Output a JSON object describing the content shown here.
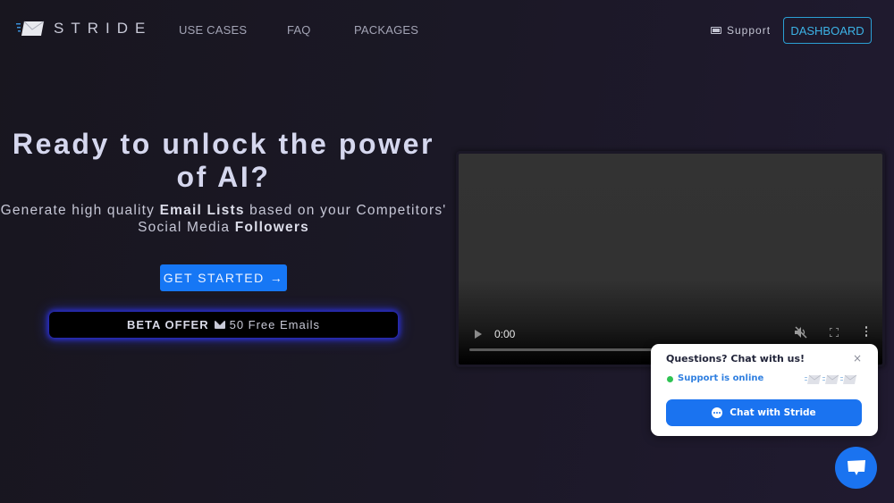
{
  "nav": {
    "logo_icon": "envelope-speed-icon",
    "brand": "STRIDE",
    "links": [
      {
        "label": "USE CASES"
      },
      {
        "label": "FAQ"
      },
      {
        "label": "PACKAGES"
      }
    ],
    "support_icon": "ticket-icon",
    "support_label": "Support",
    "dashboard_label": "DASHBOARD"
  },
  "hero": {
    "title": "Ready to unlock the power of AI?",
    "subtitle_parts": {
      "p1": "Generate high quality ",
      "b1": "Email Lists",
      "p2": " based on your Competitors' Social Media ",
      "b2": "Followers"
    },
    "cta_label": "GET STARTED",
    "cta_icon": "arrow-right-icon",
    "cta_arrow": "→",
    "beta_bold": "BETA OFFER",
    "beta_icon": "envelope-icon",
    "beta_text": "50 Free Emails"
  },
  "video": {
    "time": "0:00",
    "muted": true,
    "progress": 0
  },
  "chat_widget": {
    "title": "Questions? Chat with us!",
    "close": "×",
    "status": "Support is online",
    "status_color": "#2fc353",
    "button_label": "Chat with Stride",
    "accent": "#1a73f0"
  },
  "colors": {
    "primary": "#1677f5",
    "dashboard_border": "#2b9fd3"
  }
}
